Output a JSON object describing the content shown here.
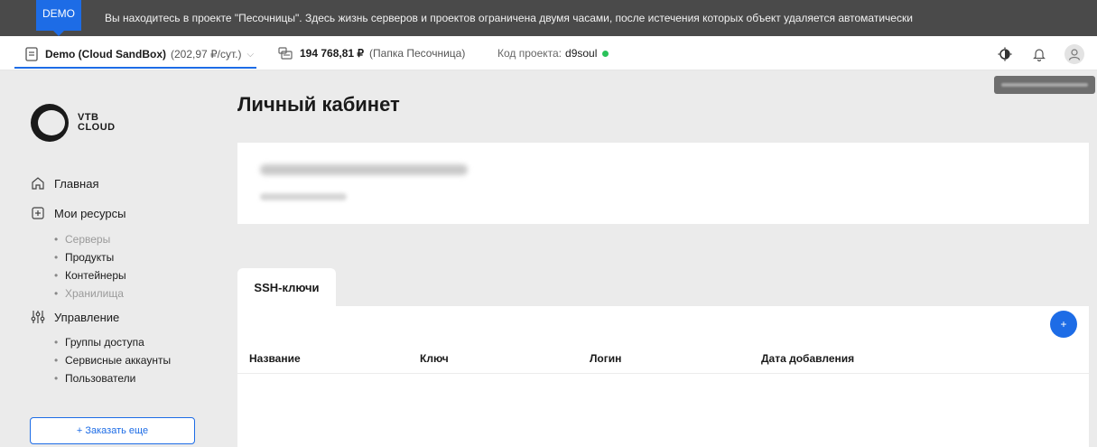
{
  "banner": {
    "tag": "DEMO",
    "message": "Вы находитесь в проекте \"Песочницы\". Здесь жизнь серверов и проектов ограничена двумя часами, после истечения которых объект удаляется автоматически"
  },
  "project_bar": {
    "project_name": "Demo (Cloud SandBox)",
    "project_rate": "(202,97 ₽/сут.)",
    "balance_amount": "194 768,81 ₽",
    "balance_folder": "(Папка Песочница)",
    "code_label": "Код проекта:",
    "code_value": "d9soul",
    "code_status_color": "#2ac25a"
  },
  "icons": [
    "document-icon",
    "chevron-down-icon",
    "wallet-icon",
    "theme-toggle-icon",
    "bell-icon",
    "user-avatar-icon",
    "home-icon",
    "add-resource-icon",
    "settings-sliders-icon"
  ],
  "logo": {
    "line1": "VTB",
    "line2": "CLOUD"
  },
  "sidebar": {
    "home": "Главная",
    "resources": "Мои ресурсы",
    "resources_items": [
      {
        "label": "Серверы",
        "muted": true
      },
      {
        "label": "Продукты",
        "muted": false
      },
      {
        "label": "Контейнеры",
        "muted": false
      },
      {
        "label": "Хранилища",
        "muted": true
      }
    ],
    "management": "Управление",
    "management_items": [
      "Группы доступа",
      "Сервисные аккаунты",
      "Пользователи"
    ],
    "order_button": "+ Заказать еще"
  },
  "main": {
    "title": "Личный кабинет",
    "tab": "SSH-ключи",
    "add_button": "+",
    "columns": [
      "Название",
      "Ключ",
      "Логин",
      "Дата добавления"
    ]
  },
  "colors": {
    "accent": "#1d6ce6",
    "banner_bg": "#4a4a4a",
    "page_bg": "#ebebeb"
  }
}
